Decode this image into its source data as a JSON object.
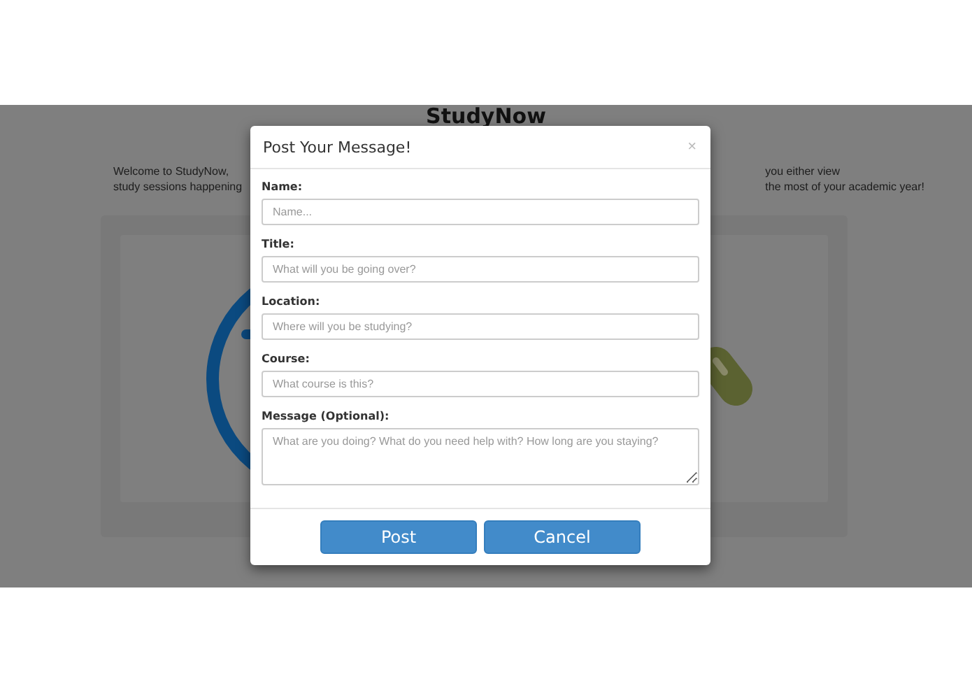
{
  "page": {
    "heading": "StudyNow",
    "intro_left": [
      "Welcome to StudyNow,",
      "study sessions happening"
    ],
    "intro_right": [
      "you either view",
      "the most of your academic year!"
    ]
  },
  "modal": {
    "title": "Post Your Message!",
    "close": "×",
    "fields": [
      {
        "kind": "input",
        "label": "Name:",
        "placeholder": "Name..."
      },
      {
        "kind": "input",
        "label": "Title:",
        "placeholder": "What will you be going over?"
      },
      {
        "kind": "input",
        "label": "Location:",
        "placeholder": "Where will you be studying?"
      },
      {
        "kind": "input",
        "label": "Course:",
        "placeholder": "What course is this?"
      },
      {
        "kind": "textarea",
        "label": "Message (Optional):",
        "placeholder": "What are you doing? What do you need help with? How long are you staying?"
      }
    ],
    "buttons": [
      {
        "label": "Post"
      },
      {
        "label": "Cancel"
      }
    ]
  }
}
